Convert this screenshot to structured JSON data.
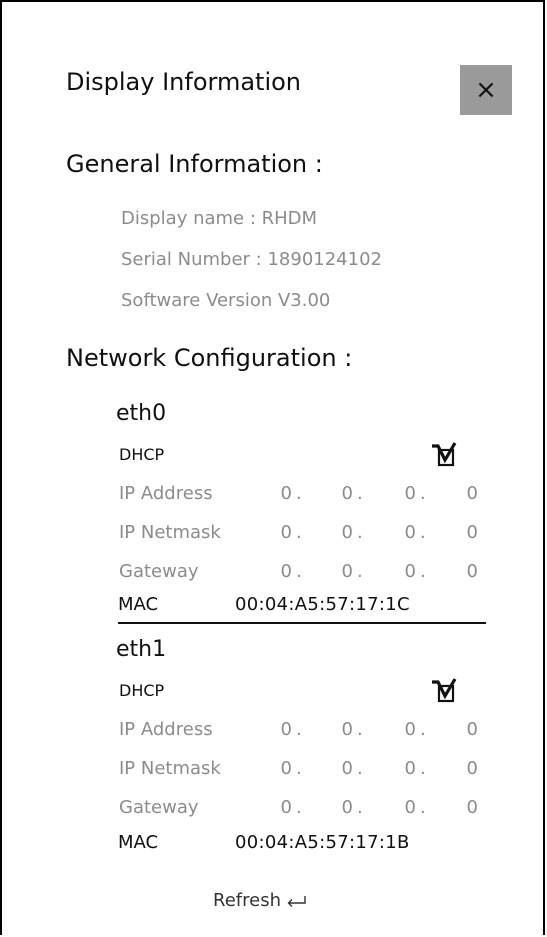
{
  "dialog": {
    "title": "Display Information",
    "close_label": "×"
  },
  "general": {
    "heading": "General Information :",
    "display_name": "Display name : RHDM",
    "serial_number": "Serial Number : 1890124102",
    "software_version": "Software Version V3.00"
  },
  "network": {
    "heading": "Network Configuration :",
    "interfaces": [
      {
        "name": "eth0",
        "dhcp_label": "DHCP",
        "dhcp_checked": true,
        "ip_label": "IP Address",
        "ip": [
          "0",
          "0",
          "0",
          "0"
        ],
        "netmask_label": "IP Netmask",
        "netmask": [
          "0",
          "0",
          "0",
          "0"
        ],
        "gateway_label": "Gateway",
        "gateway": [
          "0",
          "0",
          "0",
          "0"
        ],
        "mac_label": "MAC",
        "mac": "00:04:A5:57:17:1C"
      },
      {
        "name": "eth1",
        "dhcp_label": "DHCP",
        "dhcp_checked": true,
        "ip_label": "IP Address",
        "ip": [
          "0",
          "0",
          "0",
          "0"
        ],
        "netmask_label": "IP Netmask",
        "netmask": [
          "0",
          "0",
          "0",
          "0"
        ],
        "gateway_label": "Gateway",
        "gateway": [
          "0",
          "0",
          "0",
          "0"
        ],
        "mac_label": "MAC",
        "mac": "00:04:A5:57:17:1B"
      }
    ]
  },
  "footer": {
    "refresh_label": "Refresh",
    "refresh_icon": "enter-arrow-icon"
  },
  "colors": {
    "close_button_bg": "#9a9a9a",
    "muted_text": "#8c8c8c",
    "border": "#000000"
  }
}
